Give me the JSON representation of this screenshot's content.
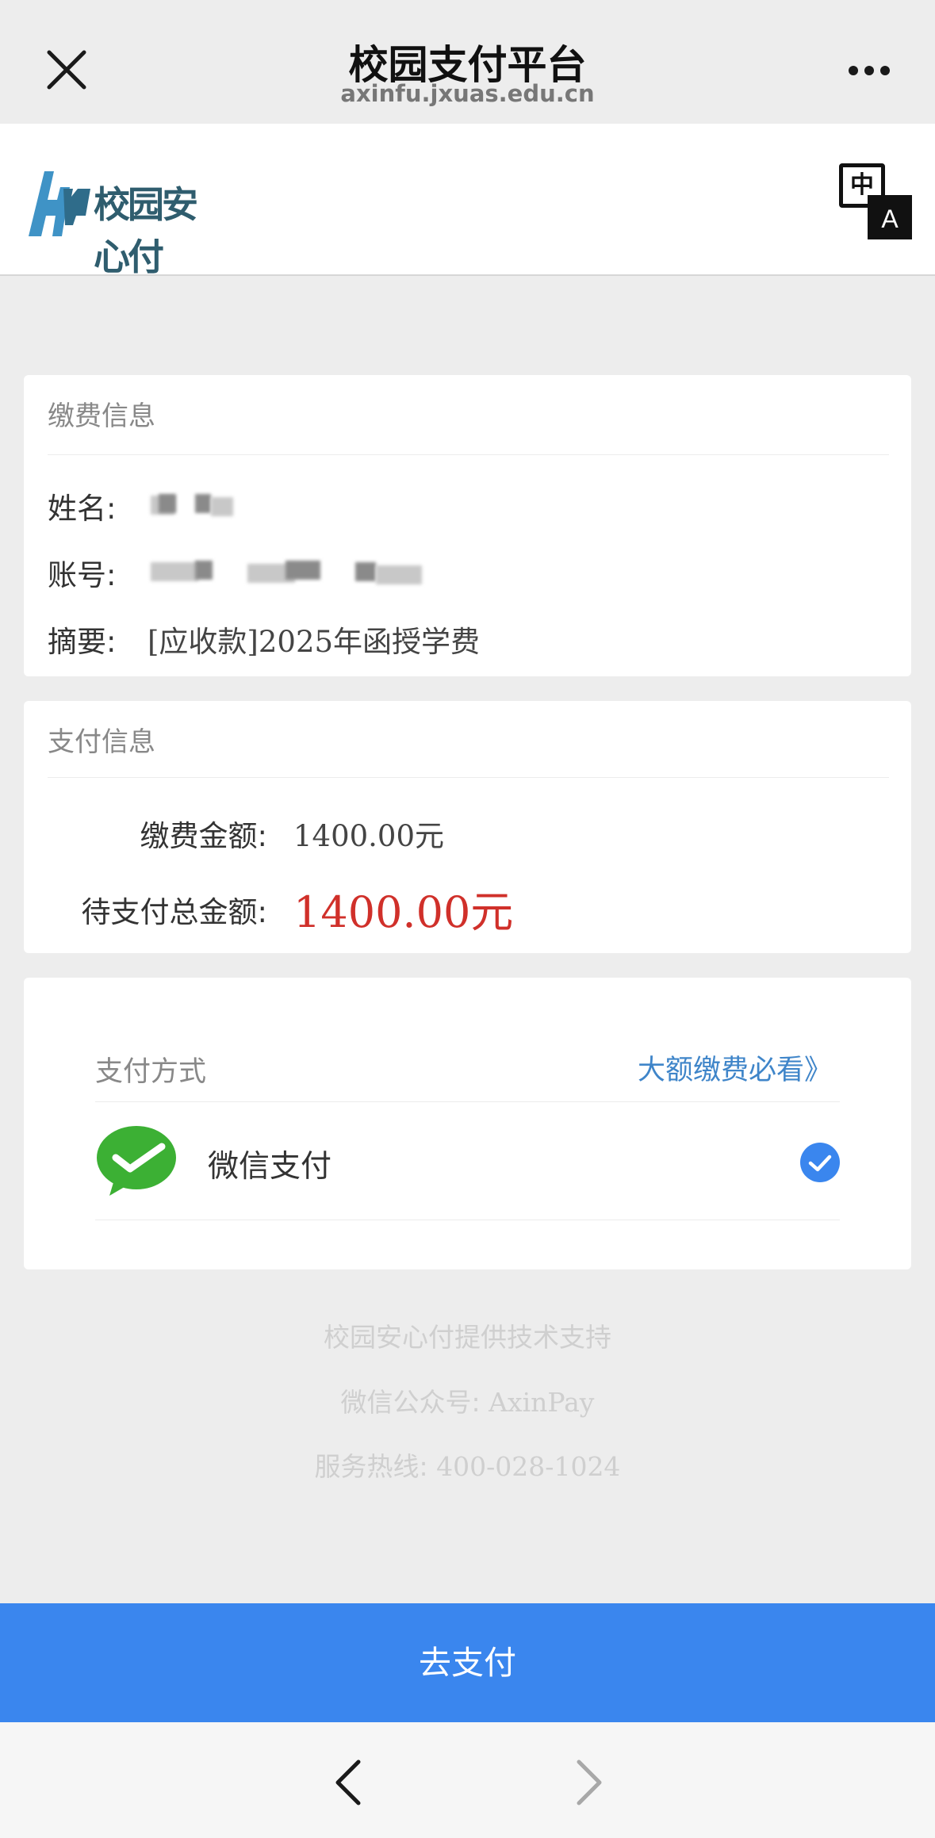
{
  "nav": {
    "title": "校园支付平台",
    "domain": "axinfu.jxuas.edu.cn"
  },
  "header": {
    "logo_text": "校园安心付",
    "lang_zh": "中",
    "lang_en": "A"
  },
  "fee_info": {
    "title": "缴费信息",
    "name_label": "姓名:",
    "account_label": "账号:",
    "summary_label": "摘要:",
    "summary_value": "[应收款]2025年函授学费"
  },
  "payment_info": {
    "title": "支付信息",
    "fee_amount_label": "缴费金额:",
    "fee_amount_value": "1400.00元",
    "total_label": "待支付总金额:",
    "total_value": "1400.00元"
  },
  "payment_method": {
    "title": "支付方式",
    "large_payment_note": "大额缴费必看》",
    "option_label": "微信支付",
    "option_selected": true
  },
  "footer": {
    "tech_support": "校园安心付提供技术支持",
    "wechat_account_label": "微信公众号:",
    "wechat_account_value": "AxinPay",
    "hotline_label": "服务热线:",
    "hotline_value": "400-028-1024"
  },
  "pay_button_label": "去支付",
  "colors": {
    "accent_blue": "#3a86ee",
    "amount_red": "#d0302a",
    "wechat_green": "#3cb034",
    "link_blue": "#3f85c9"
  },
  "icons": [
    "close-icon",
    "more-icon",
    "translate-icon",
    "wechat-pay-icon",
    "check-circle-icon",
    "back-arrow-icon",
    "forward-arrow-icon"
  ]
}
